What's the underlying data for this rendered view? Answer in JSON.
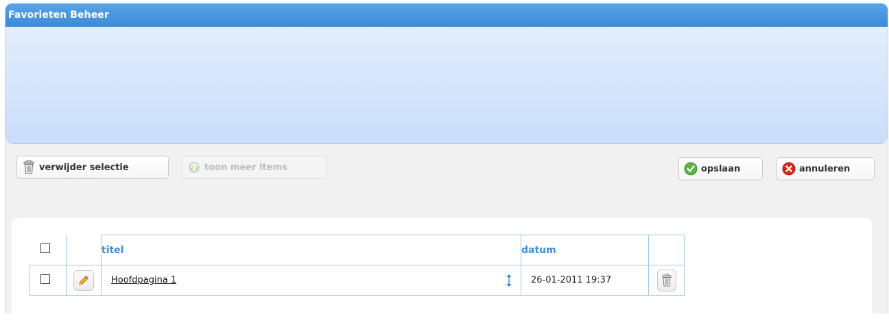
{
  "window": {
    "title": "Favorieten Beheer"
  },
  "toolbar": {
    "delete_selection_label": "verwijder selectie",
    "show_more_label": "toon meer items",
    "save_label": "opslaan",
    "cancel_label": "annuleren"
  },
  "table": {
    "headers": {
      "title": "titel",
      "date": "datum"
    },
    "rows": [
      {
        "title": "Hoofdpagina 1",
        "date": "26-01-2011 19:37"
      }
    ]
  },
  "icons": {
    "trash": "trash-icon",
    "refresh": "refresh-icon",
    "check": "check-icon",
    "cancel": "cancel-icon",
    "pencil": "pencil-icon",
    "resize": "vertical-resize-icon"
  },
  "colors": {
    "title_bar": "#3b8ad8",
    "header_text": "#3d8fd5",
    "table_border": "#9fc4e6",
    "check_green": "#4caf35",
    "cancel_red": "#d9261c"
  }
}
